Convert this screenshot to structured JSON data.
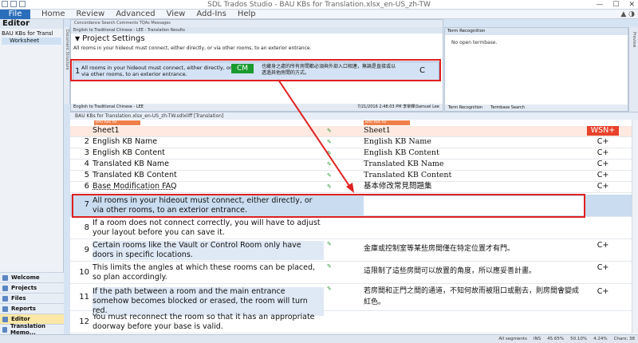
{
  "titlebar": {
    "title": "SDL Trados Studio - BAU KBs for Translation.xlsx_en-US_zh-TW"
  },
  "ribbon": {
    "file": "File",
    "tabs": [
      "Home",
      "Review",
      "Advanced",
      "View",
      "Add-Ins",
      "Help"
    ]
  },
  "leftpane": {
    "header": "Editor",
    "tree": [
      "BAU KBs for Transl",
      "Worksheet"
    ],
    "nav": [
      "Welcome",
      "Projects",
      "Files",
      "Reports",
      "Editor",
      "Translation Memo..."
    ]
  },
  "results": {
    "toptabs": "Concordance Search   Comments   TQAs   Messages",
    "caption": "English to Traditional Chinese - LEE - Translation Results",
    "section_title": "Project Settings",
    "source_text": "All rooms in your hideout must connect, either directly, or via other rooms, to an exterior entrance.",
    "row": {
      "num": "1",
      "source": "All rooms in your hideout must connect, either directly, or via other rooms, to an exterior entrance.",
      "match": "CM",
      "target": "也藏身之處的所有房間都必須與外部入口相連，無論是直接或以透過其他房間的方式。",
      "status": "C"
    },
    "bottom_left": "English to Traditional Chinese - LEE",
    "bottom_right": "7/21/2016 2:48:03 PM  李宰輝\\Samuel Lee"
  },
  "termpane": {
    "caption": "Term Recognition",
    "message": "No open termbase.",
    "tabs": [
      "Term Recognition",
      "Termbase Search"
    ]
  },
  "editor": {
    "doctab": "BAU KBs for Translation.xlsx_en-US_zh-TW.sdlxliff [Translation]",
    "tag_source": "BAU KBs for Translation.xlsx",
    "tag_target": "BAU KBs for Translation.xlsx",
    "segments": [
      {
        "n": "",
        "s": "Sheet1",
        "t": "Sheet1",
        "st": "WSN+"
      },
      {
        "n": "2",
        "s": "English KB Name",
        "t": "English KB Name",
        "st": "C+"
      },
      {
        "n": "3",
        "s": "English KB Content",
        "t": "English KB Content",
        "st": "C+"
      },
      {
        "n": "4",
        "s": "Translated KB Name",
        "t": "Translated KB Name",
        "st": "C+"
      },
      {
        "n": "5",
        "s": "Translated KB Content",
        "t": "Translated KB Content",
        "st": "C+"
      },
      {
        "n": "6",
        "s": "Base Modification FAQ",
        "t": "基本修改常見問題集",
        "st": "C+"
      },
      {
        "n": "7",
        "s": "All rooms in your hideout must connect, either directly, or via other rooms, to an exterior entrance.",
        "t": "",
        "st": ""
      },
      {
        "n": "8",
        "s": "If a room does not connect correctly, you will have to adjust your layout before you can save it.",
        "t": "",
        "st": ""
      },
      {
        "n": "9",
        "s": "Certain rooms like the Vault or Control Room only have doors in specific locations.",
        "t": "金庫或控制室等某些房間僅在特定位置才有門。",
        "st": "C+"
      },
      {
        "n": "10",
        "s": "This limits the angles at which these rooms can be placed, so plan accordingly.",
        "t": "這限制了這些房間可以放置的角度，所以應妥善計畫。",
        "st": "C+"
      },
      {
        "n": "11",
        "s": "If the path between a room and the main entrance somehow becomes blocked or erased, the room will turn red.",
        "t": "若房間和正門之間的通道，不知何故而被阻口或刪去，則房間會變成紅色。",
        "st": "C+"
      },
      {
        "n": "12",
        "s": "You must reconnect the room so that it has an appropriate doorway before your base is valid.",
        "t": "",
        "st": ""
      }
    ]
  },
  "statusbar": [
    "All segments",
    "INS",
    "45.65%",
    "50.10%",
    "4.24%",
    "Chars: 38"
  ]
}
